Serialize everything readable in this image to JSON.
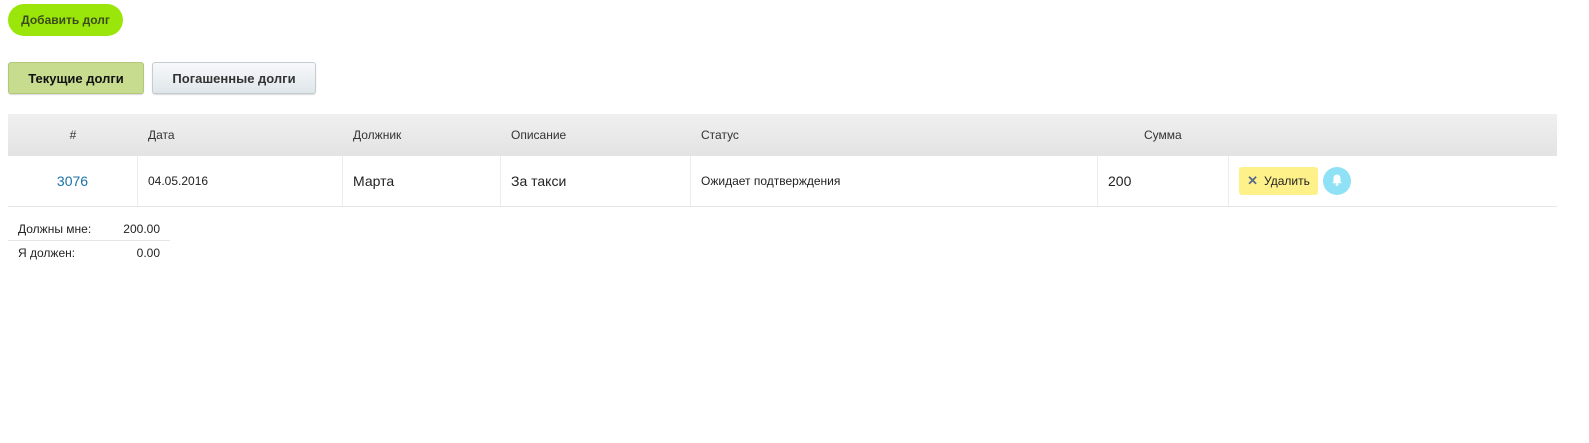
{
  "toolbar": {
    "add_label": "Добавить долг"
  },
  "tabs": [
    {
      "label": "Текущие долги",
      "active": true
    },
    {
      "label": "Погашенные долги",
      "active": false
    }
  ],
  "table": {
    "headers": [
      "#",
      "Дата",
      "Должник",
      "Описание",
      "Статус",
      "Сумма"
    ],
    "rows": [
      {
        "id": "3076",
        "date": "04.05.2016",
        "debtor": "Марта",
        "description": "За такси",
        "status": "Ожидает подтверждения",
        "amount": "200",
        "delete_label": "Удалить"
      }
    ]
  },
  "summary": {
    "owed_to_me_label": "Должны мне:",
    "owed_to_me_value": "200.00",
    "i_owe_label": "Я должен:",
    "i_owe_value": "0.00"
  },
  "colors": {
    "add_button": "#9be60a",
    "tab_active": "#c7dc8e",
    "delete_button": "#fef18a",
    "bell_button": "#8fe1f5",
    "link": "#1a73a8"
  },
  "icons": {
    "delete": "close-icon",
    "notify": "bell-icon"
  }
}
